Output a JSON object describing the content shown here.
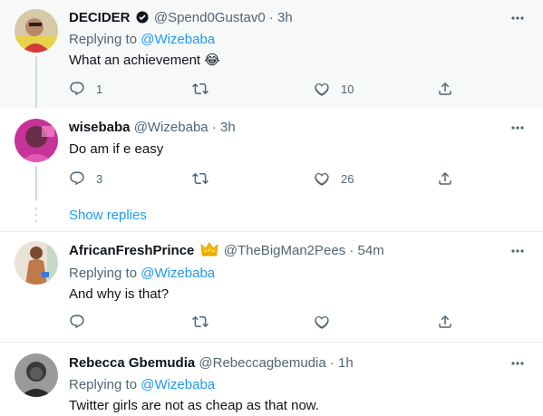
{
  "tweets": [
    {
      "name": "DECIDER",
      "handle": "@Spend0Gustav0",
      "time": "3h",
      "replying_prefix": "Replying to ",
      "replying_to": "@Wizebaba",
      "text": "What an achievement 😂",
      "replies": "1",
      "retweets": "",
      "likes": "10"
    },
    {
      "name": "wisebaba",
      "handle": "@Wizebaba",
      "time": "3h",
      "text": "Do am if e easy",
      "replies": "3",
      "retweets": "",
      "likes": "26",
      "show_replies": "Show replies"
    },
    {
      "name": "AfricanFreshPrince",
      "handle": "@TheBigMan2Pees",
      "time": "54m",
      "replying_prefix": "Replying to ",
      "replying_to": "@Wizebaba",
      "text": "And why is that?",
      "replies": "",
      "retweets": "",
      "likes": ""
    },
    {
      "name": "Rebecca Gbemudia",
      "handle": "@Rebeccagbemudia",
      "time": "1h",
      "replying_prefix": "Replying to ",
      "replying_to": "@Wizebaba",
      "text": "Twitter girls are not as cheap as that now."
    }
  ],
  "colors": {
    "accent": "#1d9bf0",
    "secondary_text": "#536471",
    "highlight_bg": "#f7f9f9"
  },
  "icons": [
    "more-icon",
    "reply-icon",
    "retweet-icon",
    "like-icon",
    "share-icon",
    "crown-icon",
    "verified-dark-icon"
  ]
}
